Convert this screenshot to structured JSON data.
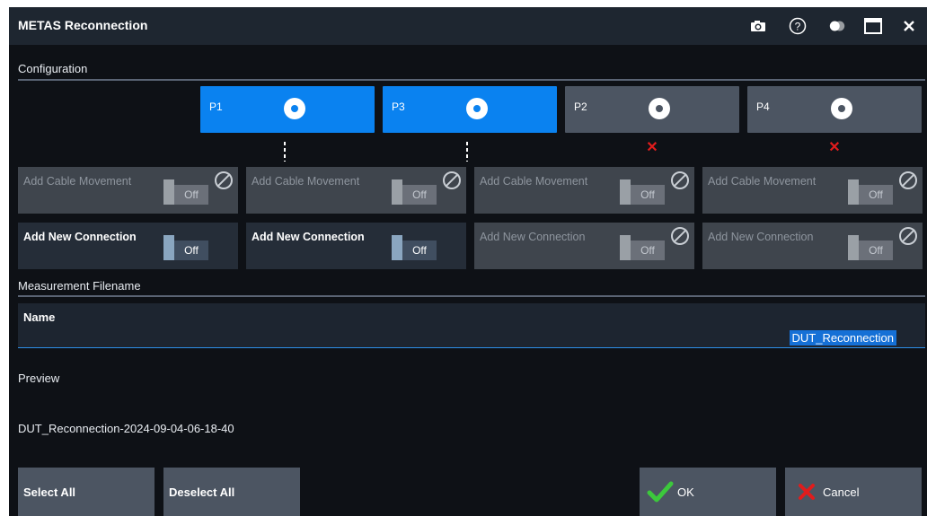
{
  "window": {
    "title": "METAS Reconnection",
    "icons": [
      "camera-icon",
      "help-icon",
      "toggle-display-icon",
      "maximize-icon",
      "close-icon"
    ]
  },
  "configuration": {
    "label": "Configuration",
    "ports": [
      {
        "label": "P1",
        "active": true,
        "connector": "dashed"
      },
      {
        "label": "P3",
        "active": true,
        "connector": "dashed"
      },
      {
        "label": "P2",
        "active": false,
        "connector": "x"
      },
      {
        "label": "P4",
        "active": false,
        "connector": "x"
      }
    ],
    "cable_movement": [
      {
        "label": "Add Cable Movement",
        "state": "Off",
        "enabled": false
      },
      {
        "label": "Add Cable Movement",
        "state": "Off",
        "enabled": false
      },
      {
        "label": "Add Cable Movement",
        "state": "Off",
        "enabled": false
      },
      {
        "label": "Add Cable Movement",
        "state": "Off",
        "enabled": false
      }
    ],
    "new_connection": [
      {
        "label": "Add New Connection",
        "state": "Off",
        "enabled": true
      },
      {
        "label": "Add New Connection",
        "state": "Off",
        "enabled": true
      },
      {
        "label": "Add New Connection",
        "state": "Off",
        "enabled": false
      },
      {
        "label": "Add New Connection",
        "state": "Off",
        "enabled": false
      }
    ]
  },
  "filename": {
    "section_label": "Measurement Filename",
    "name_label": "Name",
    "name_value": "DUT_Reconnection",
    "preview_label": "Preview",
    "preview_value": "DUT_Reconnection-2024-09-04-06-18-40"
  },
  "buttons": {
    "select_all": "Select All",
    "deselect_all": "Deselect All",
    "ok": "OK",
    "cancel": "Cancel"
  },
  "colors": {
    "accent": "#0a82f0",
    "ok_check": "#3cc83c",
    "cancel_x": "#e11c1c"
  }
}
